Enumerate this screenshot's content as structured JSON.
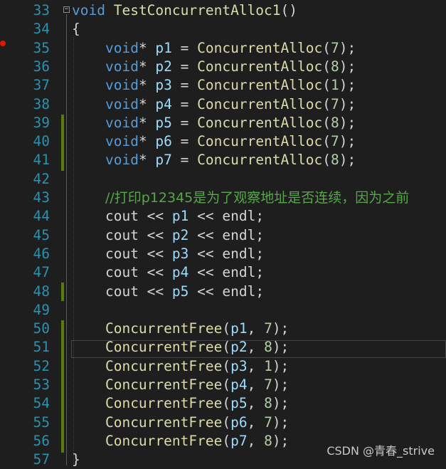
{
  "gutter": {
    "line_numbers": [
      "33",
      "34",
      "35",
      "36",
      "37",
      "38",
      "39",
      "40",
      "41",
      "42",
      "43",
      "44",
      "45",
      "46",
      "47",
      "48",
      "49",
      "50",
      "51",
      "52",
      "53",
      "54",
      "55",
      "56",
      "57"
    ]
  },
  "code": {
    "func_kw": "void",
    "func_name": "TestConcurrentAlloc1",
    "func_parens": "()",
    "open_brace": "{",
    "close_brace": "}",
    "alloc_fn": "ConcurrentAlloc",
    "free_fn": "ConcurrentFree",
    "void_kw": "void",
    "allocs": [
      {
        "var": "p1",
        "arg": "7"
      },
      {
        "var": "p2",
        "arg": "8"
      },
      {
        "var": "p3",
        "arg": "1"
      },
      {
        "var": "p4",
        "arg": "7"
      },
      {
        "var": "p5",
        "arg": "8"
      },
      {
        "var": "p6",
        "arg": "7"
      },
      {
        "var": "p7",
        "arg": "8"
      }
    ],
    "comment": "//打印p12345是为了观察地址是否连续，因为之前",
    "cout_kw": "cout",
    "endl_kw": "endl",
    "couts": [
      "p1",
      "p2",
      "p3",
      "p4",
      "p5"
    ],
    "frees": [
      {
        "var": "p1",
        "arg": "7"
      },
      {
        "var": "p2",
        "arg": "8"
      },
      {
        "var": "p3",
        "arg": "1"
      },
      {
        "var": "p4",
        "arg": "7"
      },
      {
        "var": "p5",
        "arg": "8"
      },
      {
        "var": "p6",
        "arg": "7"
      },
      {
        "var": "p7",
        "arg": "8"
      }
    ]
  },
  "watermark": "CSDN @青春_strive",
  "colors": {
    "background": "#1e1e1e",
    "keyword": "#569cd6",
    "function": "#dcdcaa",
    "variable": "#9cdcfe",
    "number": "#b5cea8",
    "comment": "#57a64a",
    "line_number": "#2b91af",
    "change_bar": "#587c0c",
    "breakpoint": "#e51400"
  }
}
